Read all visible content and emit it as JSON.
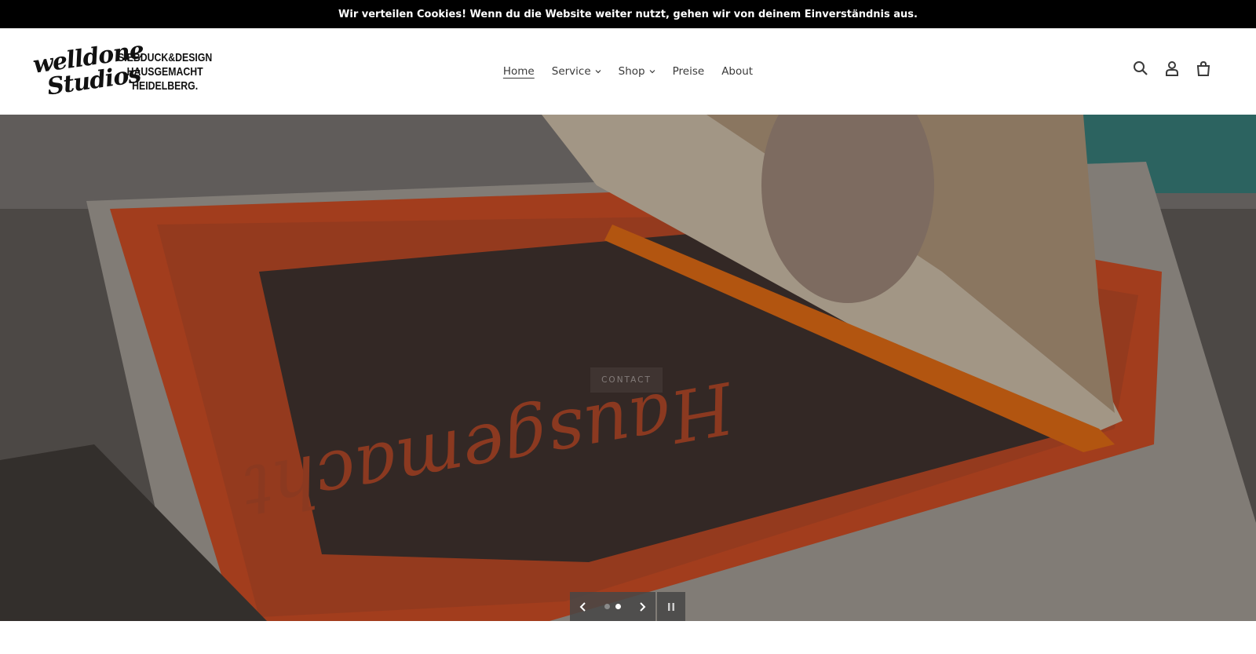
{
  "cookie_bar": {
    "text": "Wir verteilen Cookies! Wenn du die Website weiter nutzt, gehen wir von deinem Einverständnis aus."
  },
  "logo": {
    "script_line1": "welldone",
    "script_line2": "Studios",
    "text_line1": "SIEBDUCK&DESIGN",
    "text_line2": "HAUSGEMACHT",
    "text_line3": "HEIDELBERG."
  },
  "nav": {
    "items": [
      {
        "label": "Home",
        "active": true
      },
      {
        "label": "Service",
        "dropdown": true
      },
      {
        "label": "Shop",
        "dropdown": true
      },
      {
        "label": "Preise"
      },
      {
        "label": "About"
      }
    ]
  },
  "header_icons": [
    "search-icon",
    "account-icon",
    "cart-icon"
  ],
  "hero": {
    "button_label": "CONTACT",
    "slides_total": 2,
    "active_slide": 2
  },
  "colors": {
    "cookie_bg": "#000000",
    "ink_orange": "#e8582a",
    "text": "#3a3a3a"
  }
}
